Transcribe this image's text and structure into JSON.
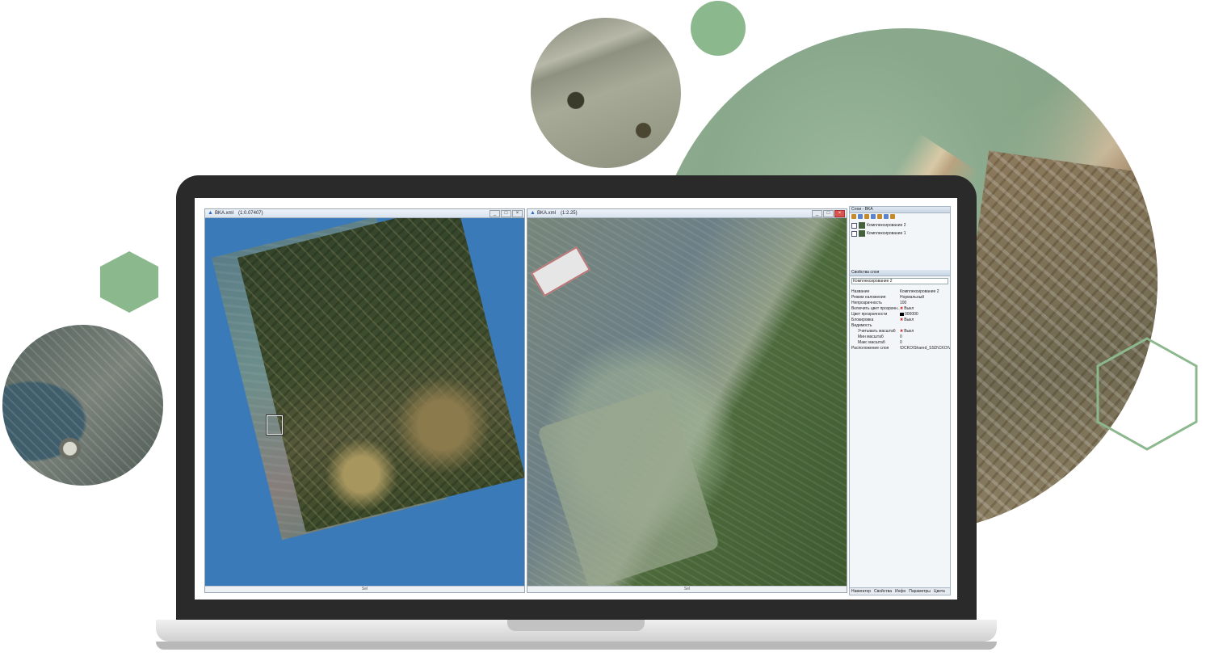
{
  "decor": {
    "accent_color": "#8cb88e",
    "laptop_color": "#2a2a2a"
  },
  "windows": {
    "left": {
      "title": "BKA.xml",
      "zoom": "(1:0.07407)",
      "status": "Sel"
    },
    "right": {
      "title": "BKA.xml",
      "zoom": "(1:2.25)",
      "status": "Sel"
    },
    "controls": {
      "minimize": "_",
      "maximize": "□",
      "close": "×"
    }
  },
  "layers_panel": {
    "title": "Слои - BKA",
    "layers": [
      {
        "name": "Комплексирование 2"
      },
      {
        "name": "Комплексирование 1"
      }
    ],
    "props_title": "Свойства слоя",
    "selected_layer": "Комплексирование 2",
    "properties": [
      {
        "key": "Название",
        "value": "Комплексирование 2"
      },
      {
        "key": "Режим наложения",
        "value": "Нормальный"
      },
      {
        "key": "Непрозрачность",
        "value": "100"
      },
      {
        "key": "Включить цвет прозрачн...",
        "value": "Выкл"
      },
      {
        "key": "Цвет прозрачности",
        "value": "000000"
      },
      {
        "key": "Блокировка",
        "value": "Выкл"
      },
      {
        "key": "Видимость",
        "value": ""
      },
      {
        "key": "Учитывать масштаб",
        "value": "Выкл"
      },
      {
        "key": "Мин масштаб",
        "value": "0"
      },
      {
        "key": "Макс масштаб",
        "value": "0"
      },
      {
        "key": "Расположение слоя",
        "value": "\\DCKO\\Shared_SSD\\CKO\\VT..."
      }
    ],
    "tabs": [
      "Навигатор",
      "Свойства",
      "Инфо",
      "Параметры",
      "Цвета"
    ]
  }
}
